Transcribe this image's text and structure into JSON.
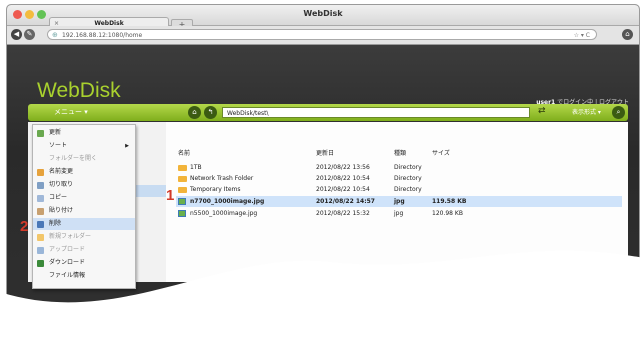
{
  "window": {
    "title": "WebDisk"
  },
  "tab": {
    "title": "WebDisk",
    "close": "×",
    "new_tab": "+"
  },
  "address_bar": {
    "url": "192.168.88.12:1080/home",
    "right_controls": "☆ ▾ C"
  },
  "app": {
    "logo": "WebDisk",
    "user_name": "user1",
    "user_status": "でログイン中 | ログアウト",
    "menu_label": "メニュー",
    "path": "WebDisk/test\\",
    "sort_label": "表示形式"
  },
  "table": {
    "headers": [
      "名前",
      "更新日",
      "種類",
      "サイズ"
    ],
    "rows": [
      {
        "name": "1TB",
        "date": "2012/08/22 13:56",
        "type": "Directory",
        "size": "",
        "kind": "folder",
        "selected": false
      },
      {
        "name": "Network Trash Folder",
        "date": "2012/08/22 10:54",
        "type": "Directory",
        "size": "",
        "kind": "folder",
        "selected": false
      },
      {
        "name": "Temporary Items",
        "date": "2012/08/22 10:54",
        "type": "Directory",
        "size": "",
        "kind": "folder",
        "selected": false
      },
      {
        "name": "n7700_1000image.jpg",
        "date": "2012/08/22 14:57",
        "type": "jpg",
        "size": "119.58 KB",
        "kind": "image",
        "selected": true
      },
      {
        "name": "n5500_1000image.jpg",
        "date": "2012/08/22 15:32",
        "type": "jpg",
        "size": "120.98 KB",
        "kind": "image",
        "selected": false
      }
    ]
  },
  "context_menu": {
    "items": [
      {
        "label": "更新",
        "disabled": false,
        "highlight": false,
        "icon_color": "#6aa84f"
      },
      {
        "label": "ソート",
        "disabled": false,
        "highlight": false,
        "icon_color": "",
        "submenu": true
      },
      {
        "label": "フォルダーを開く",
        "disabled": true,
        "highlight": false,
        "icon_color": ""
      },
      {
        "label": "名前変更",
        "disabled": false,
        "highlight": false,
        "icon_color": "#e6a23c"
      },
      {
        "label": "切り取り",
        "disabled": false,
        "highlight": false,
        "icon_color": "#7f9fc4"
      },
      {
        "label": "コピー",
        "disabled": false,
        "highlight": false,
        "icon_color": "#a0b8d8"
      },
      {
        "label": "貼り付け",
        "disabled": false,
        "highlight": false,
        "icon_color": "#c8a070"
      },
      {
        "label": "削除",
        "disabled": false,
        "highlight": true,
        "icon_color": "#4a78b8"
      },
      {
        "label": "新規フォルダー",
        "disabled": true,
        "highlight": false,
        "icon_color": "#f2c66a"
      },
      {
        "label": "アップロード",
        "disabled": true,
        "highlight": false,
        "icon_color": "#9ab6d8"
      },
      {
        "label": "ダウンロード",
        "disabled": false,
        "highlight": false,
        "icon_color": "#3b8a3a"
      },
      {
        "label": "ファイル情報",
        "disabled": false,
        "highlight": false,
        "icon_color": ""
      }
    ]
  },
  "callouts": {
    "one": "1",
    "two": "2"
  },
  "colors": {
    "accent_green": "#a9d12e",
    "selection": "#cfe3fa",
    "callout_red": "#d23a2a"
  }
}
